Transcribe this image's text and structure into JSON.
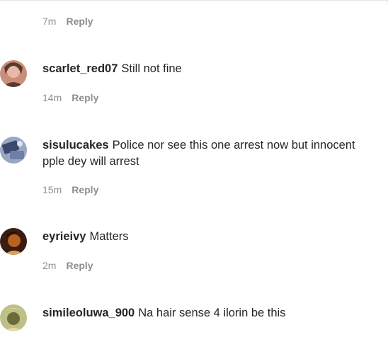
{
  "top_comment": {
    "time": "7m",
    "reply_label": "Reply"
  },
  "comments": [
    {
      "username": "scarlet_red07",
      "text": "Still not fine",
      "time": "14m",
      "reply_label": "Reply",
      "avatar_colors": [
        "#5a3a2e",
        "#c98d7a",
        "#e8b8a8"
      ]
    },
    {
      "username": "sisulucakes",
      "text": "Police nor see this one arrest now but innocent pple dey will arrest",
      "time": "15m",
      "reply_label": "Reply",
      "avatar_colors": [
        "#3a4a6e",
        "#9aa6c4",
        "#6d7fa8"
      ]
    },
    {
      "username": "eyrieivy",
      "text": "Matters",
      "time": "2m",
      "reply_label": "Reply",
      "avatar_colors": [
        "#3a1c10",
        "#b8621e",
        "#e0a060"
      ]
    },
    {
      "username": "simileoluwa_900",
      "text": "Na hair sense 4 ilorin be this",
      "avatar_colors": [
        "#6a6a3a",
        "#e8d8a8",
        "#bfbf88"
      ]
    }
  ]
}
